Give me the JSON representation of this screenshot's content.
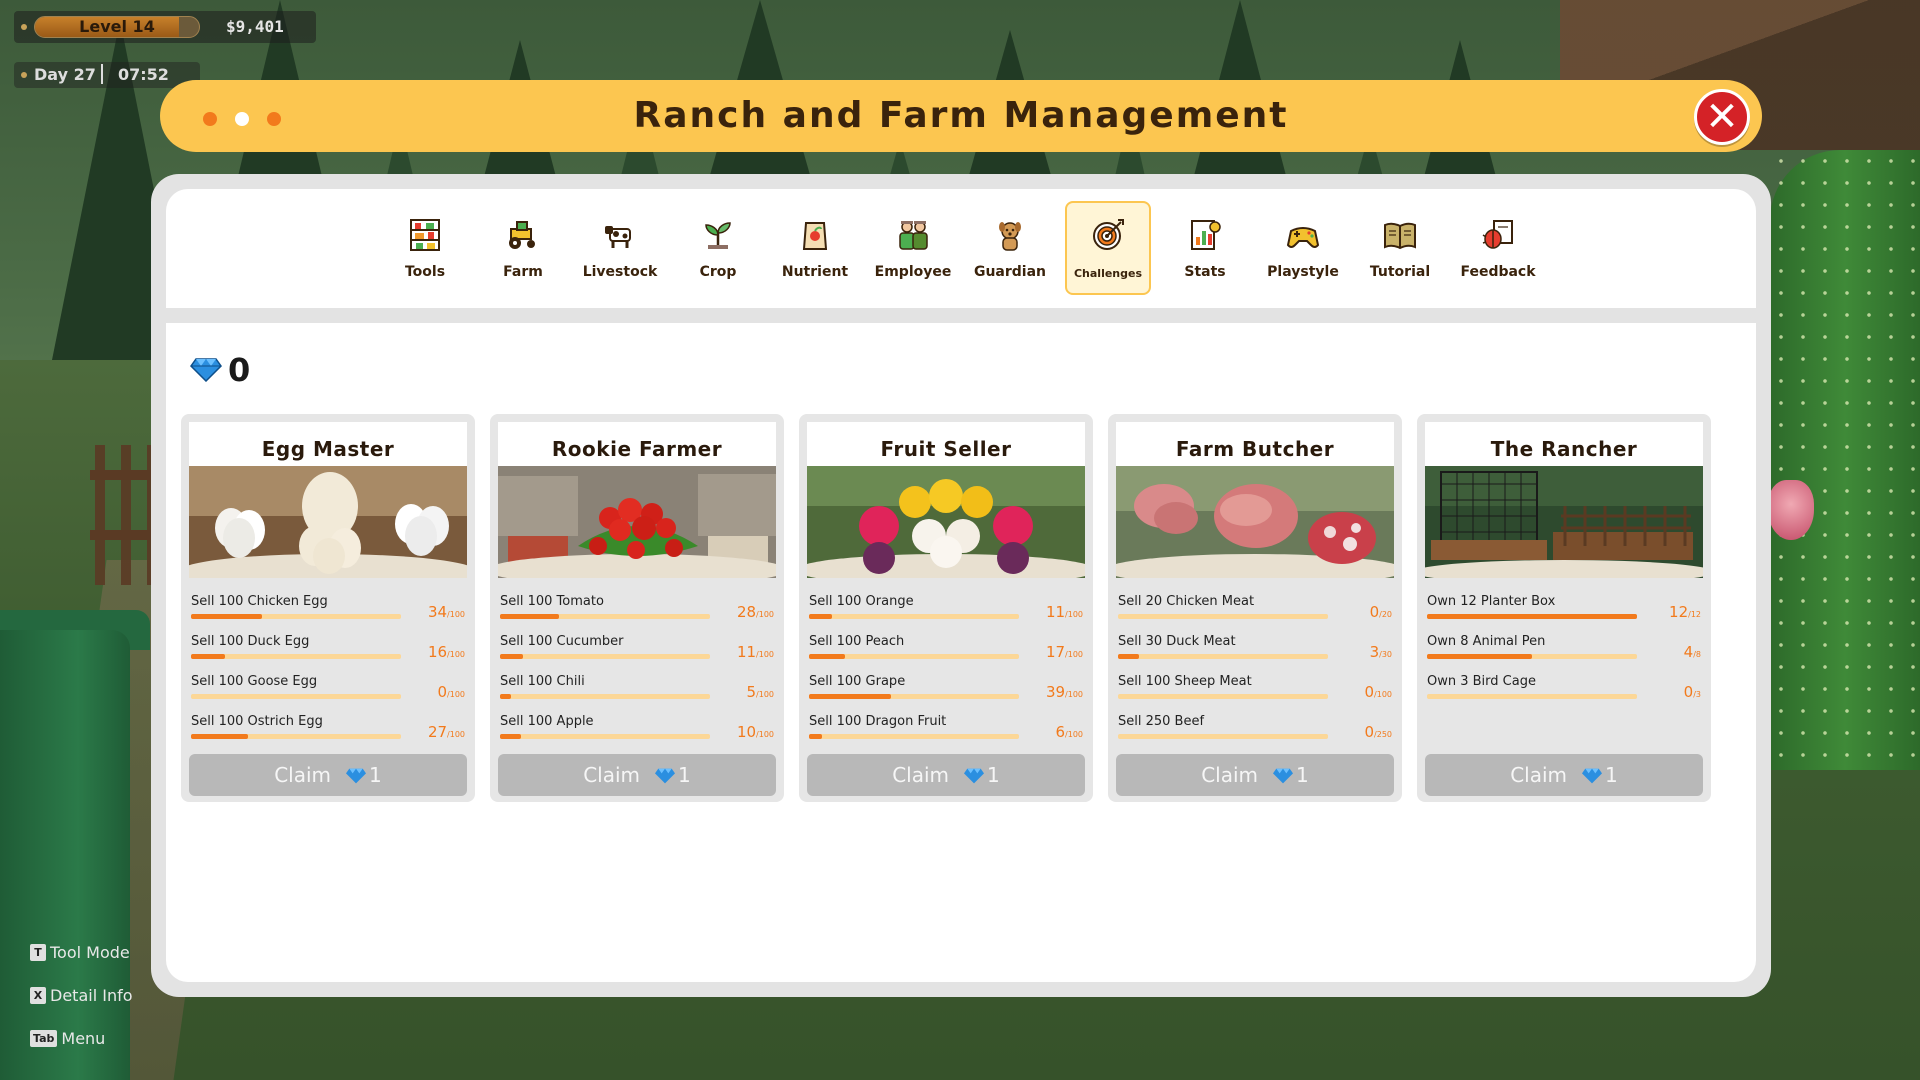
{
  "hud": {
    "level": "Level 14",
    "level_progress": 0.88,
    "money": "$9,401",
    "day": "Day 27",
    "time": "07:52"
  },
  "window": {
    "title": "Ranch and Farm Management",
    "close_symbol": "✕"
  },
  "tabs": [
    {
      "label": "Tools",
      "icon": "tools-shelf-icon"
    },
    {
      "label": "Farm",
      "icon": "tractor-icon"
    },
    {
      "label": "Livestock",
      "icon": "cow-icon"
    },
    {
      "label": "Crop",
      "icon": "sprout-icon"
    },
    {
      "label": "Nutrient",
      "icon": "fertilizer-bag-icon"
    },
    {
      "label": "Employee",
      "icon": "workers-icon"
    },
    {
      "label": "Guardian",
      "icon": "dog-icon"
    },
    {
      "label": "Challenges",
      "icon": "target-icon",
      "active": true
    },
    {
      "label": "Stats",
      "icon": "stats-icon"
    },
    {
      "label": "Playstyle",
      "icon": "gamepad-icon"
    },
    {
      "label": "Tutorial",
      "icon": "book-icon"
    },
    {
      "label": "Feedback",
      "icon": "bug-icon"
    }
  ],
  "gems": {
    "count": "0",
    "icon": "diamond-icon"
  },
  "cards": [
    {
      "name": "Egg Master",
      "image": "eggs-image",
      "goals": [
        {
          "label": "Sell 100 Chicken Egg",
          "current": "34",
          "total": "/100",
          "progress": 0.34
        },
        {
          "label": "Sell 100 Duck Egg",
          "current": "16",
          "total": "/100",
          "progress": 0.16
        },
        {
          "label": "Sell 100 Goose Egg",
          "current": "0",
          "total": "/100",
          "progress": 0
        },
        {
          "label": "Sell 100 Ostrich Egg",
          "current": "27",
          "total": "/100",
          "progress": 0.27
        }
      ],
      "claim": {
        "label": "Claim",
        "reward": "1"
      }
    },
    {
      "name": "Rookie Farmer",
      "image": "vegetables-image",
      "goals": [
        {
          "label": "Sell 100 Tomato",
          "current": "28",
          "total": "/100",
          "progress": 0.28
        },
        {
          "label": "Sell 100 Cucumber",
          "current": "11",
          "total": "/100",
          "progress": 0.11
        },
        {
          "label": "Sell 100 Chili",
          "current": "5",
          "total": "/100",
          "progress": 0.05
        },
        {
          "label": "Sell 100 Apple",
          "current": "10",
          "total": "/100",
          "progress": 0.1
        }
      ],
      "claim": {
        "label": "Claim",
        "reward": "1"
      }
    },
    {
      "name": "Fruit Seller",
      "image": "fruits-image",
      "goals": [
        {
          "label": "Sell 100 Orange",
          "current": "11",
          "total": "/100",
          "progress": 0.11
        },
        {
          "label": "Sell 100 Peach",
          "current": "17",
          "total": "/100",
          "progress": 0.17
        },
        {
          "label": "Sell 100 Grape",
          "current": "39",
          "total": "/100",
          "progress": 0.39
        },
        {
          "label": "Sell 100 Dragon Fruit",
          "current": "6",
          "total": "/100",
          "progress": 0.06
        }
      ],
      "claim": {
        "label": "Claim",
        "reward": "1"
      }
    },
    {
      "name": "Farm Butcher",
      "image": "meat-image",
      "goals": [
        {
          "label": "Sell 20 Chicken Meat",
          "current": "0",
          "total": "/20",
          "progress": 0
        },
        {
          "label": "Sell 30 Duck Meat",
          "current": "3",
          "total": "/30",
          "progress": 0.1
        },
        {
          "label": "Sell 100 Sheep Meat",
          "current": "0",
          "total": "/100",
          "progress": 0
        },
        {
          "label": "Sell 250 Beef",
          "current": "0",
          "total": "/250",
          "progress": 0
        }
      ],
      "claim": {
        "label": "Claim",
        "reward": "1"
      }
    },
    {
      "name": "The Rancher",
      "image": "ranch-pens-image",
      "goals": [
        {
          "label": "Own 12 Planter Box",
          "current": "12",
          "total": "/12",
          "progress": 1
        },
        {
          "label": "Own 8 Animal Pen",
          "current": "4",
          "total": "/8",
          "progress": 0.5
        },
        {
          "label": "Own 3 Bird Cage",
          "current": "0",
          "total": "/3",
          "progress": 0
        }
      ],
      "claim": {
        "label": "Claim",
        "reward": "1"
      }
    }
  ],
  "hints": [
    {
      "key": "T",
      "label": "Tool Mode"
    },
    {
      "key": "X",
      "label": "Detail Info"
    },
    {
      "key": "Tab",
      "label": "Menu"
    }
  ],
  "colors": {
    "accent": "#fcc650",
    "progress": "#f27a1c",
    "track": "#fcd797",
    "claim_disabled": "#b8b8b8",
    "close": "#d42227",
    "gem": "#2b8fe0"
  }
}
